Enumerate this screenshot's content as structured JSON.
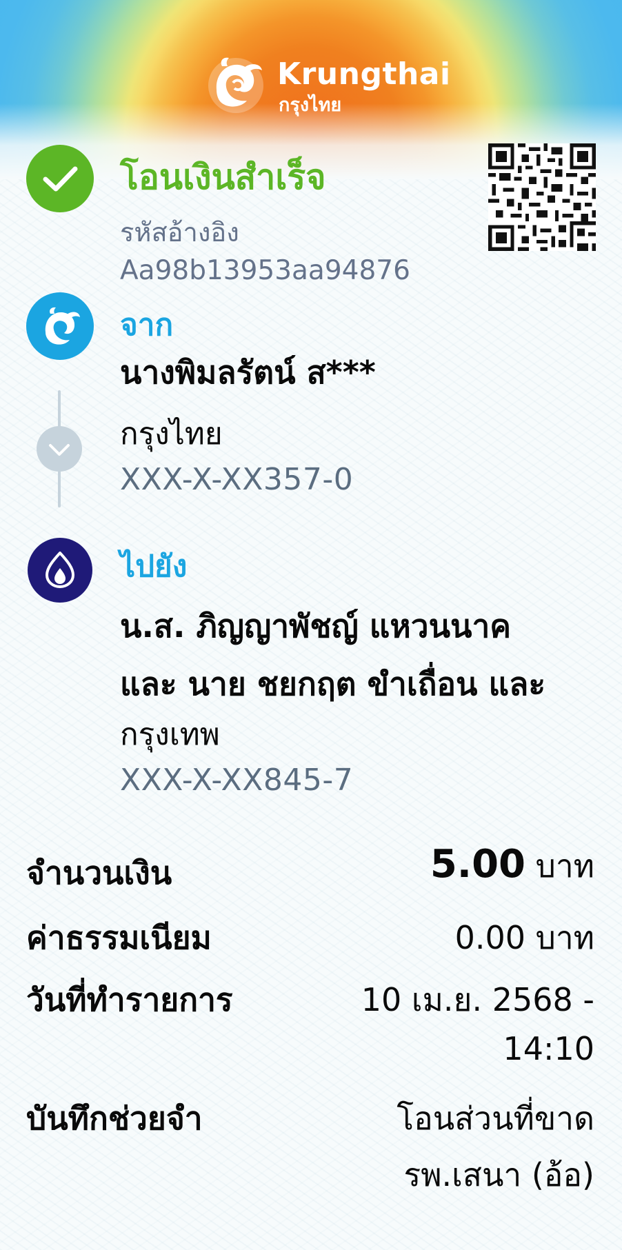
{
  "header": {
    "brand_en": "Krungthai",
    "brand_th": "กรุงไทย"
  },
  "status": {
    "title": "โอนเงินสำเร็จ",
    "ref_label": "รหัสอ้างอิง",
    "ref_code": "Aa98b13953aa94876",
    "color": "#5cb626"
  },
  "from": {
    "label": "จาก",
    "name": "นางพิมลรัตน์ ส***",
    "bank": "กรุงไทย",
    "account": "XXX-X-XX357-0",
    "icon": "krungthai-logo-icon",
    "icon_color": "#1ba5e1"
  },
  "to": {
    "label": "ไปยัง",
    "name_line1": "น.ส. ภิญญาพัชญ์ แหวนนาค",
    "name_line2": "และ นาย ชยกฤต ขำเถื่อน และ",
    "bank": "กรุงเทพ",
    "account": "XXX-X-XX845-7",
    "icon": "bangkok-bank-lotus-icon",
    "icon_color": "#1f1a78"
  },
  "details": {
    "amount_label": "จำนวนเงิน",
    "amount_value": "5.00",
    "amount_unit": "บาท",
    "fee_label": "ค่าธรรมเนียม",
    "fee_value": "0.00 บาท",
    "date_label": "วันที่ทำรายการ",
    "date_line1": "10 เม.ย. 2568 -",
    "date_line2": "14:10",
    "memo_label": "บันทึกช่วยจำ",
    "memo_line1": "โอนส่วนที่ขาด",
    "memo_line2": "รพ.เสนา (อ้อ)"
  },
  "qr_code": {
    "icon": "qr-code-icon"
  }
}
